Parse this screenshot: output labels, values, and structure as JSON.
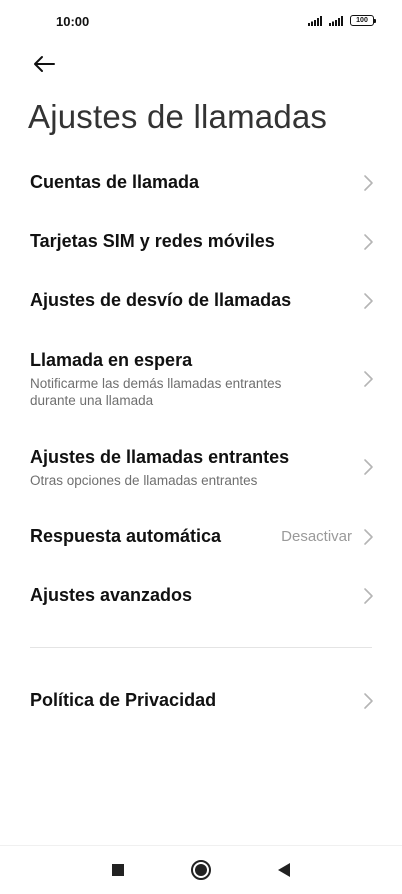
{
  "status_bar": {
    "time": "10:00",
    "battery": "100",
    "icons": [
      "signal-icon",
      "signal-icon",
      "battery-icon"
    ]
  },
  "header": {
    "back_icon": "arrow-left-icon",
    "title": "Ajustes de llamadas"
  },
  "settings": {
    "items": [
      {
        "title": "Cuentas de llamada"
      },
      {
        "title": "Tarjetas SIM y redes móviles"
      },
      {
        "title": "Ajustes de desvío de llamadas"
      },
      {
        "title": "Llamada en espera",
        "subtitle": "Notificarme las demás llamadas entrantes durante una llamada"
      },
      {
        "title": "Ajustes de llamadas entrantes",
        "subtitle": "Otras opciones de llamadas entrantes"
      },
      {
        "title": "Respuesta automática",
        "value": "Desactivar"
      },
      {
        "title": "Ajustes avanzados"
      },
      {
        "title": "Política de Privacidad"
      }
    ]
  },
  "nav_bar": {
    "icons": [
      "recents-square-icon",
      "home-circle-icon",
      "back-triangle-icon"
    ]
  },
  "colors": {
    "title": "#333333",
    "item_title": "#111111",
    "subtitle": "#6f6f6f",
    "value": "#9a9a9a",
    "chevron": "#b5b5b5",
    "divider": "#e4e4e4"
  }
}
